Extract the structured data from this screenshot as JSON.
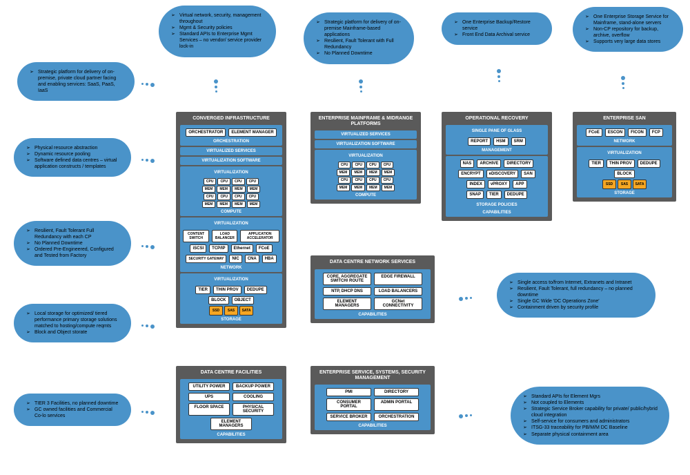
{
  "clouds": {
    "c1": [
      "Virtual network, security, management throughout",
      "Mgmt & Security policies",
      "Standard APIs to Enterprise Mgmt Services – no vendor/ service provider lock-in"
    ],
    "c2": [
      "Strategic platform for delivery of on-premise Mainframe-based applications",
      "Resilient, Fault Tolerant with Full Redundancy",
      "No Planned Downtime"
    ],
    "c3": [
      "One Enterprise Backup/Restore service",
      "Front End Data Archival service"
    ],
    "c4": [
      "One Enterprise Storage Service for Mainframe, stand-alone servers",
      "Non-CP repository for backup, archive, overflow",
      "Supports very large data stores"
    ],
    "c5": [
      "Strategic platform for delivery of on-premise, private cloud partner facing and enabling services: SaaS, PaaS, IaaS"
    ],
    "c6": [
      "Physical resource abstraction",
      "Dynamic resource pooling",
      "Software defined data centres – virtual application constructs / templates"
    ],
    "c7": [
      "Resilient, Fault Tolerant Full Redundancy with each CP",
      "No Planned Downtime",
      "Ordered Pre-Engineered, Configured and Tested from Factory"
    ],
    "c8": [
      "Local storage for optimized/ tiered performance primary storage solutions matched to hosting/compute reqmts",
      "Block and Object storate"
    ],
    "c9": [
      "TIER 3 Facilities, no planned downtime",
      "GC owned facilities and Commercial Co-lo services"
    ],
    "c10": [
      "Single access to/from Internet, Extranets and Intranet",
      "Resilient, Fault Tolerant, full redundancy – no planned downtime",
      "Single GC Wide 'DC Operations Zone'",
      "Containment driven by security profile"
    ],
    "c11": [
      "Standard APIs for Element Mgrs",
      "Not coupled to Elements",
      "Strategic Service Broker capability for private/ public/hybrid cloud integration",
      "Self-service for consumers and administrators",
      "ITSG-33 traceability for PB/M/M DC Baseline",
      "Separate physical containment area"
    ]
  },
  "panels": {
    "conv": {
      "title": "CONVERGED INFRASTRUCTURE",
      "orch": [
        "ORCHESTRATOR",
        "ELEMENT MANAGER"
      ],
      "orch_l": "ORCHESTRATION",
      "vs": "VIRTUALIZED SERVICES",
      "vsw": "VIRTUALIZATION SOFTWARE",
      "virt": "VIRTUALIZATION",
      "cpu": "CPU",
      "mem": "MEM",
      "compute": "COMPUTE",
      "net_virt": "VIRTUALIZATION",
      "net_r1": [
        "CONTENT SWITCH",
        "LOAD BALANCER",
        "APPLICATION ACCELERATOR"
      ],
      "net_r2": [
        "iSCSI",
        "TCP/IP",
        "Ethernet",
        "FCoE"
      ],
      "net_r3": [
        "SECURITY GATEWAY",
        "CNA",
        "HBA"
      ],
      "net_r3b": "NIC",
      "network": "NETWORK",
      "st_virt": "VIRTUALIZATION",
      "st_r1": [
        "TIER",
        "THIN PROV",
        "DEDUPE"
      ],
      "st_r2": [
        "BLOCK",
        "OBJECT"
      ],
      "disks": [
        "SSD",
        "SAS",
        "SATA"
      ],
      "storage": "STORAGE"
    },
    "mf": {
      "title": "ENTERPRISE MAINFRAME & MIDRANGE PLATFORMS",
      "vs": "VIRTUALIZED SERVICES",
      "vsw": "VIRTUALIZATION SOFTWARE",
      "virt": "VIRTUALIZATION",
      "cpu": "CPU",
      "mem": "MEM",
      "compute": "COMPUTE"
    },
    "op": {
      "title": "OPERATIONAL RECOVERY",
      "spg": "SINGLE PANE OF GLASS",
      "mgmt_r": [
        "REPORT",
        "HSM",
        "SRM"
      ],
      "mgmt": "MANAGEMENT",
      "cap_r1": [
        "NAS",
        "ARCHIVE",
        "DIRECTORY"
      ],
      "cap_r2": [
        "ENCRYPT",
        "eDISCOVERY",
        "SAN"
      ],
      "cap_r3": [
        "INDEX",
        "vPROXY",
        "APP"
      ],
      "cap_r4": [
        "SNAP",
        "TIER",
        "DEDUPE"
      ],
      "sp": "STORAGE POLICIES",
      "cap": "CAPABILITIES"
    },
    "san": {
      "title": "ENTERPRISE SAN",
      "net_r": [
        "FCoE",
        "ESCON",
        "FICON",
        "FCP"
      ],
      "network": "NETWORK",
      "virt": "VIRTUALIZATION",
      "st_r1": [
        "TIER",
        "THIN PROV",
        "DEDUPE"
      ],
      "block": "BLOCK",
      "disks": [
        "SSD",
        "SAS",
        "SATA"
      ],
      "storage": "STORAGE"
    },
    "dcns": {
      "title": "DATA CENTRE NETWORK SERVICES",
      "r1": [
        "CORE, AGGREGATE SWITCH/ ROUTE",
        "EDGE FIREWALL"
      ],
      "r2": [
        "NTP, DHCP DNS",
        "LOAD BALANCERS"
      ],
      "r3": [
        "ELEMENT MANAGERS",
        "GCNet CONNECTIVITY"
      ],
      "cap": "CAPABILITIES"
    },
    "dcf": {
      "title": "DATA CENTRE FACILITIES",
      "r1": [
        "UTILITY POWER",
        "BACKUP POWER"
      ],
      "r2": [
        "UPS",
        "COOLING"
      ],
      "r3": [
        "FLOOR SPACE",
        "PHYSICAL SECURITY"
      ],
      "r4": [
        "ELEMENT MANAGERS"
      ],
      "cap": "CAPABILITIES"
    },
    "essm": {
      "title": "ENTERPRISE SERVICE, SYSTEMS, SECURITY MANAGEMENT",
      "r1": [
        "PMI",
        "DIRECTORY"
      ],
      "r2": [
        "CONSUMER PORTAL",
        "ADMIN PORTAL"
      ],
      "r3": [
        "SERVICE BROKER",
        "ORCHESTRATION"
      ],
      "cap": "CAPABILITIES"
    }
  }
}
